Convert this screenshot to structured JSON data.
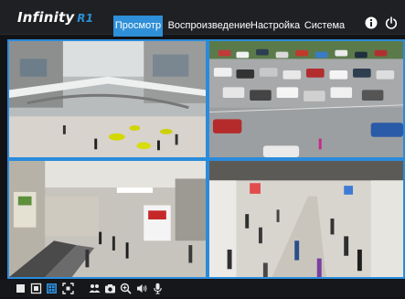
{
  "header": {
    "logo_text": "Infinity",
    "logo_accent": "R1",
    "nav": [
      {
        "label": "Просмотр",
        "active": true
      },
      {
        "label": "Воспроизведение",
        "active": false
      },
      {
        "label": "Настройка",
        "active": false
      },
      {
        "label": "Система",
        "active": false
      }
    ],
    "icons": [
      "info-icon",
      "power-icon"
    ]
  },
  "layout": "2x2",
  "cameras": [
    {
      "id": "cam-1",
      "scene": "mall-atrium"
    },
    {
      "id": "cam-2",
      "scene": "parking-lot"
    },
    {
      "id": "cam-3",
      "scene": "mall-escalator"
    },
    {
      "id": "cam-4",
      "scene": "exhibition-hall"
    }
  ],
  "toolbar": {
    "icons": [
      "layout-1-icon",
      "layout-4-icon",
      "layout-9-icon",
      "fullscreen-icon",
      "people-icon",
      "snapshot-icon",
      "zoom-icon",
      "audio-icon",
      "microphone-icon"
    ],
    "active_icon": "layout-9-icon"
  },
  "colors": {
    "accent": "#2f8fd8",
    "tile_border": "#2a8bdb",
    "background": "#121316"
  }
}
